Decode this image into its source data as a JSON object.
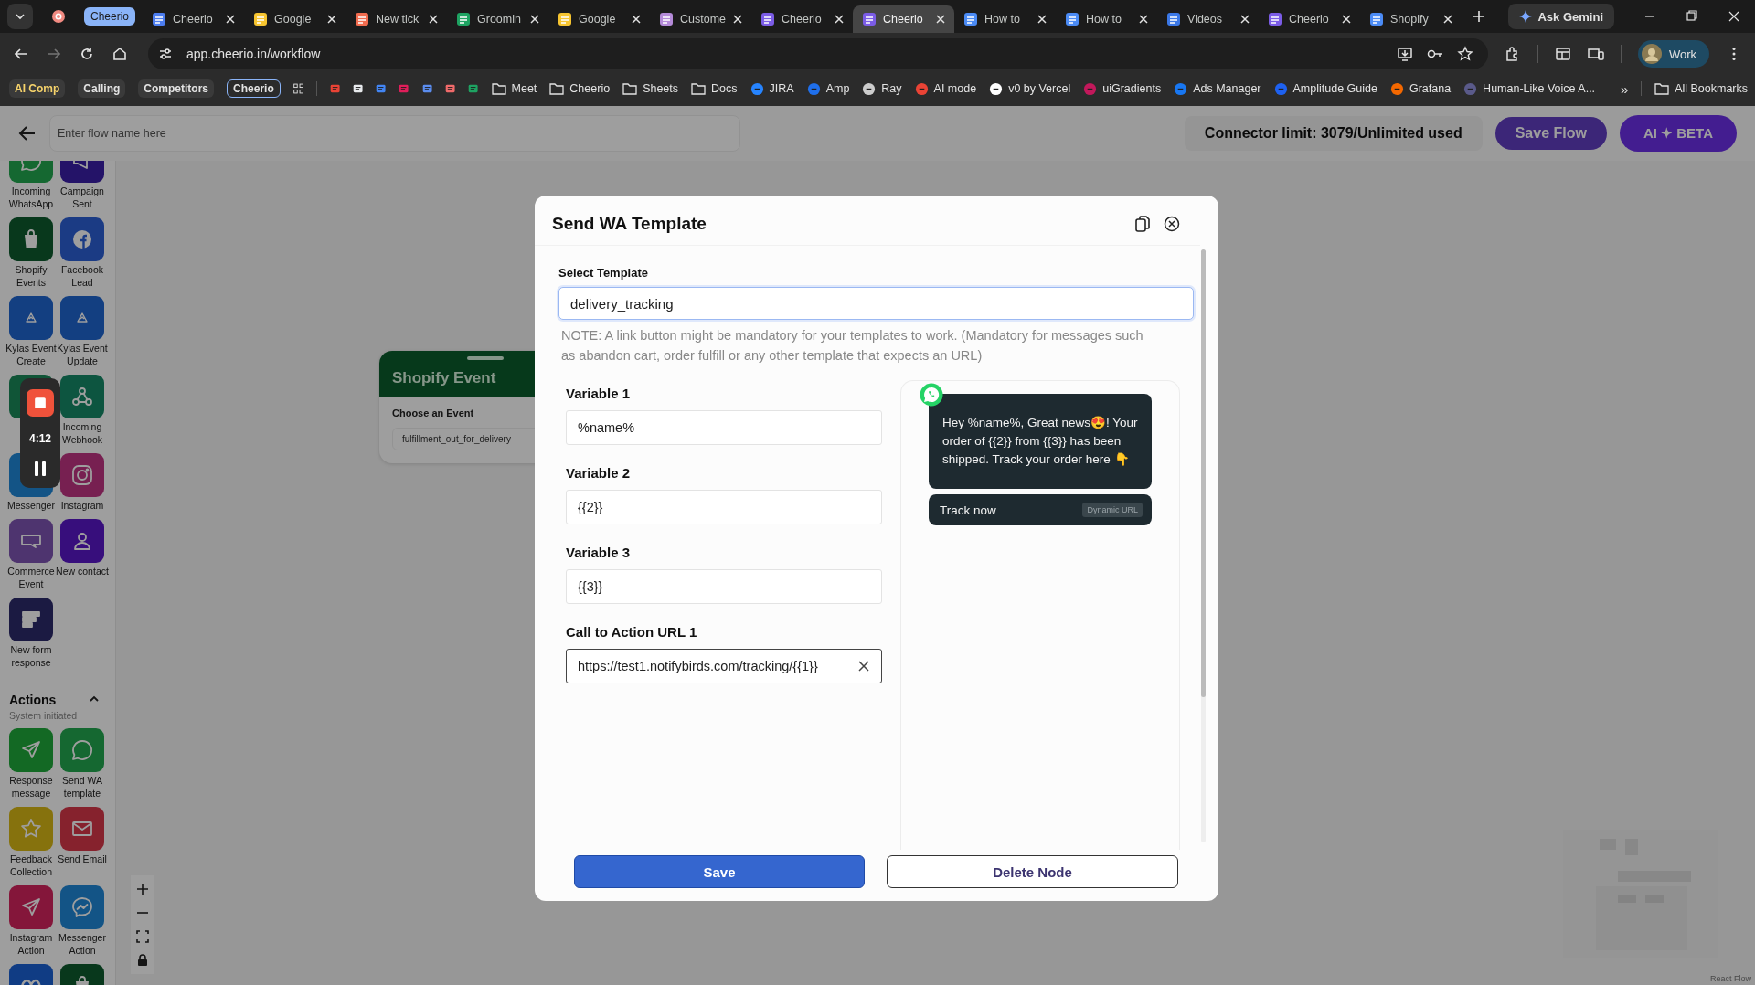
{
  "browser": {
    "tab_group": {
      "label": "Cheerio",
      "color": "#8ab4f8"
    },
    "tabs": [
      {
        "selected": false,
        "color": "#f28b82"
      },
      {
        "title": "Cheerio",
        "selected": false,
        "color": "#4c7df0"
      },
      {
        "title": "Google",
        "selected": false,
        "color": "#f7c530"
      },
      {
        "title": "New tick",
        "selected": false,
        "color": "#f26c4f"
      },
      {
        "title": "Groomin",
        "selected": false,
        "color": "#1ea362"
      },
      {
        "title": "Google",
        "selected": false,
        "color": "#f7c530"
      },
      {
        "title": "Custome",
        "selected": false,
        "color": "#b48ad8"
      },
      {
        "title": "Cheerio",
        "selected": false,
        "color": "#7b5ce6"
      },
      {
        "title": "Cheerio",
        "selected": true,
        "color": "#7b5ce6"
      },
      {
        "title": "How to",
        "selected": false,
        "color": "#4b8bf5"
      },
      {
        "title": "How to",
        "selected": false,
        "color": "#4b8bf5"
      },
      {
        "title": "Videos",
        "selected": false,
        "color": "#3b78e7"
      },
      {
        "title": "Cheerio",
        "selected": false,
        "color": "#7b5ce6"
      },
      {
        "title": "Shopify",
        "selected": false,
        "color": "#4b8bf5"
      }
    ],
    "ask_gemini": "Ask Gemini",
    "url": "app.cheerio.in/workflow",
    "forward_disabled": true,
    "profile": "Work",
    "bookmarks": [
      {
        "kind": "chip",
        "label": "AI Comp",
        "color": "#f6d36b"
      },
      {
        "kind": "chip",
        "label": "Calling",
        "color": "#e3e3e3"
      },
      {
        "kind": "chip",
        "label": "Competitors",
        "color": "#e3e3e3"
      },
      {
        "kind": "group",
        "label": "Cheerio",
        "color": "#8ab4f8"
      },
      {
        "kind": "apps"
      },
      {
        "kind": "site",
        "color": "#ea4335"
      },
      {
        "kind": "site",
        "color": "#e8eaed"
      },
      {
        "kind": "site",
        "color": "#4285f4"
      },
      {
        "kind": "site",
        "color": "#e01e5a"
      },
      {
        "kind": "site",
        "color": "#5b8def"
      },
      {
        "kind": "site",
        "color": "#f06a6a"
      },
      {
        "kind": "site",
        "color": "#1ea362"
      },
      {
        "kind": "folder",
        "label": "Meet"
      },
      {
        "kind": "folder",
        "label": "Cheerio"
      },
      {
        "kind": "folder",
        "label": "Sheets"
      },
      {
        "kind": "folder",
        "label": "Docs"
      },
      {
        "kind": "site",
        "label": "JIRA",
        "color": "#2684ff"
      },
      {
        "kind": "site",
        "label": "Amp",
        "color": "#1f6feb"
      },
      {
        "kind": "site",
        "label": "Ray",
        "color": "#cccccc"
      },
      {
        "kind": "site",
        "label": "AI mode",
        "color": "#ea4335"
      },
      {
        "kind": "site",
        "label": "v0 by Vercel",
        "color": "#ffffff"
      },
      {
        "kind": "site",
        "label": "uiGradients",
        "color": "#c2185b"
      },
      {
        "kind": "site",
        "label": "Ads Manager",
        "color": "#1877f2"
      },
      {
        "kind": "site",
        "label": "Amplitude Guide",
        "color": "#1e61f0"
      },
      {
        "kind": "site",
        "label": "Grafana",
        "color": "#f46800"
      },
      {
        "kind": "site",
        "label": "Human-Like Voice A...",
        "color": "#5a5a8a"
      }
    ],
    "overflow": "»",
    "all_bookmarks": "All Bookmarks"
  },
  "header": {
    "flow_name_placeholder": "Enter flow name here",
    "connector_limit": "Connector limit: 3079/Unlimited used",
    "save_flow": "Save Flow",
    "ai_button": "AI ✦ BETA"
  },
  "sidebar": {
    "triggers": [
      {
        "label": "Incoming WhatsApp",
        "kind": "whatsapp"
      },
      {
        "label": "Campaign Sent",
        "kind": "megaphone"
      },
      {
        "label": "Shopify Events",
        "kind": "shopify"
      },
      {
        "label": "Facebook Lead",
        "kind": "facebook"
      },
      {
        "label": "Kylas Event Create",
        "kind": "kylas"
      },
      {
        "label": "Kylas Event Update",
        "kind": "kylas"
      },
      {
        "kind": "generic"
      },
      {
        "label": "Incoming Webhook",
        "kind": "webhook"
      },
      {
        "label": "Messenger",
        "kind": "messenger"
      },
      {
        "label": "Instagram",
        "kind": "instagram"
      },
      {
        "label": "Commerce Event",
        "kind": "woo"
      },
      {
        "label": "New contact",
        "kind": "person"
      },
      {
        "label": "New form response",
        "kind": "form"
      }
    ],
    "actions": {
      "title": "Actions",
      "subtitle": "System initiated",
      "expanded": true,
      "items": [
        {
          "label": "Response message",
          "kind": "send"
        },
        {
          "label": "Send WA template",
          "kind": "whatsapp"
        },
        {
          "label": "Feedback Collection",
          "kind": "star"
        },
        {
          "label": "Send Email",
          "kind": "mail"
        },
        {
          "label": "Instagram Action",
          "kind": "direct"
        },
        {
          "label": "Messenger Action",
          "kind": "messenger"
        },
        {
          "kind": "meta"
        },
        {
          "kind": "shopify"
        }
      ]
    }
  },
  "recorder": {
    "time": "4:12"
  },
  "canvas": {
    "node": {
      "title": "Shopify Event",
      "field_label": "Choose an Event",
      "value": "fulfillment_out_for_delivery"
    },
    "attribution": "React Flow"
  },
  "modal": {
    "title": "Send WA Template",
    "template": {
      "label": "Select Template",
      "value": "delivery_tracking",
      "focused": true
    },
    "note": "NOTE: A link button might be mandatory for your templates to work. (Mandatory for messages such as abandon cart, order fulfill or any other template that expects an URL)",
    "variables": [
      {
        "label": "Variable 1",
        "value": "%name%"
      },
      {
        "label": "Variable 2",
        "value": "{{2}}"
      },
      {
        "label": "Variable 3",
        "value": "{{3}}"
      }
    ],
    "cta": {
      "label": "Call to Action URL 1",
      "value": "https://test1.notifybirds.com/tracking/{{1}}"
    },
    "preview": {
      "message": "Hey %name%, Great news😍! Your order of {{2}} from {{3}} has been shipped. Track your order here 👇",
      "button_label": "Track now",
      "button_tag": "Dynamic URL"
    },
    "save": "Save",
    "delete": "Delete Node"
  }
}
